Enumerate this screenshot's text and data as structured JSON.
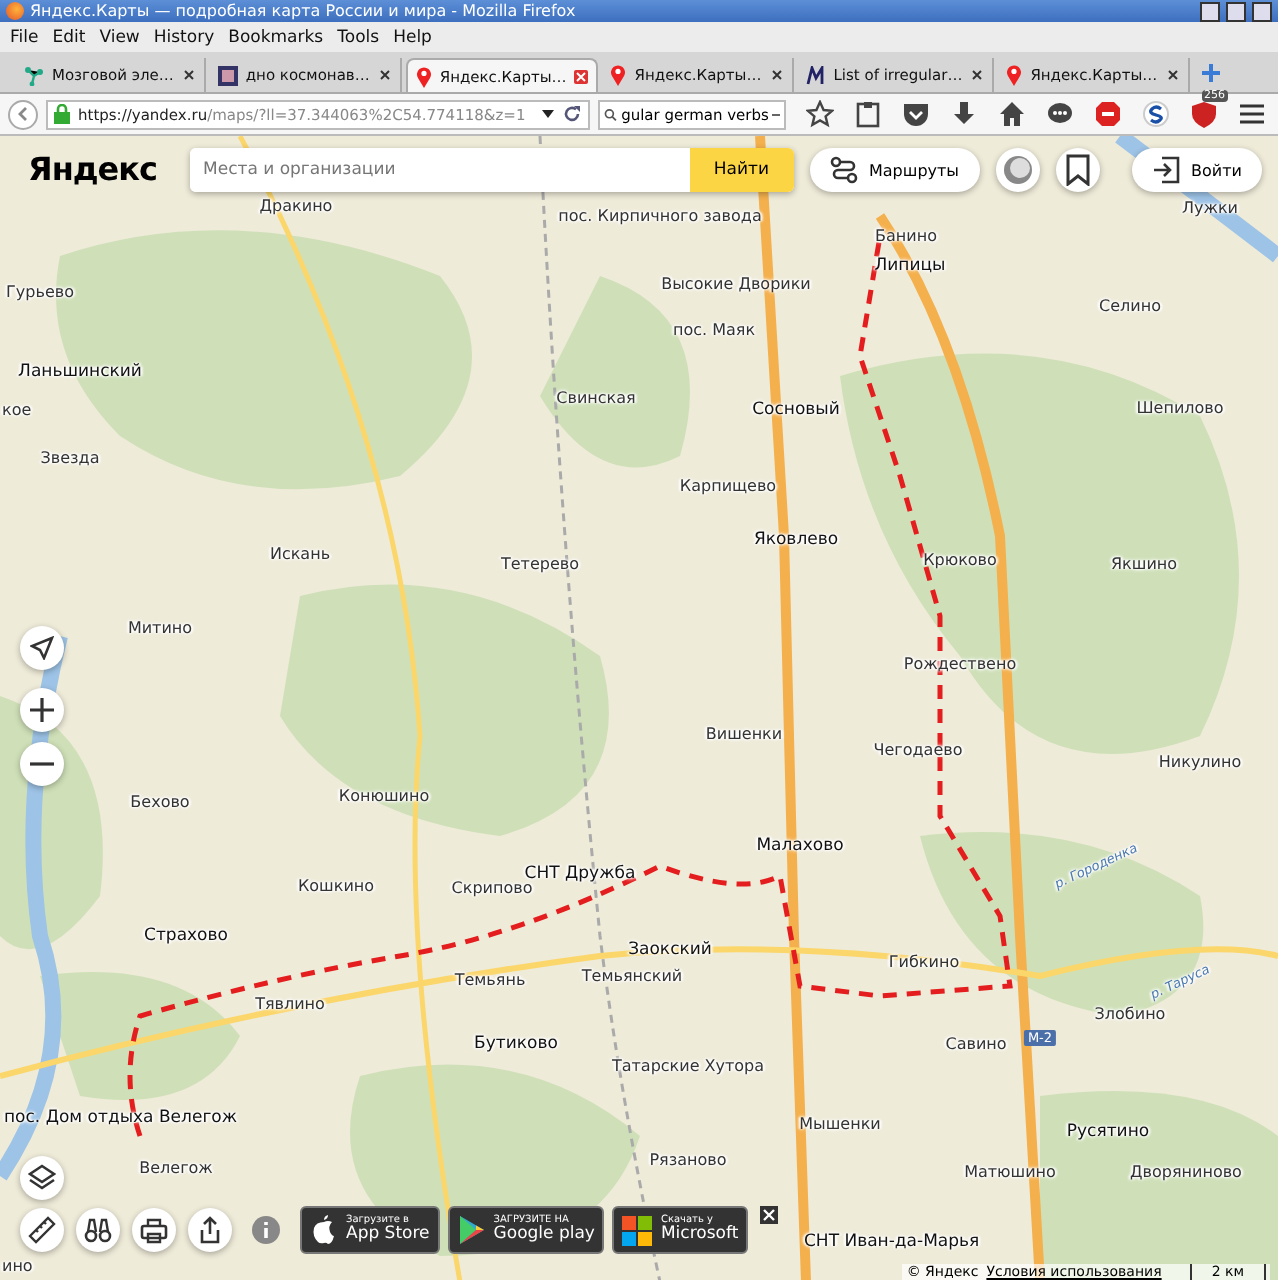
{
  "window": {
    "title": "Яндекс.Карты — подробная карта России и мира - Mozilla Firefox"
  },
  "menu": [
    "File",
    "Edit",
    "View",
    "History",
    "Bookmarks",
    "Tools",
    "Help"
  ],
  "tabs": [
    {
      "label": "Мозговой эле…",
      "kind": "nodes",
      "selected": false
    },
    {
      "label": "дно космонав…",
      "kind": "image",
      "selected": false
    },
    {
      "label": "Яндекс.Карты…",
      "kind": "pin",
      "selected": true
    },
    {
      "label": "Яндекс.Карты…",
      "kind": "pin",
      "selected": false
    },
    {
      "label": "List of irregular…",
      "kind": "letter",
      "selected": false
    },
    {
      "label": "Яндекс.Карты…",
      "kind": "pin",
      "selected": false
    }
  ],
  "address": {
    "host": "https://yandex.ru",
    "path": "/maps/?ll=37.344063%2C54.774118&z=1"
  },
  "web_search": {
    "value": "gular german verbs"
  },
  "toolbar": {
    "badge": "256"
  },
  "header": {
    "logo": "Яндекс",
    "search_placeholder": "Места и организации",
    "search_button": "Найти",
    "routes_button": "Маршруты",
    "login_button": "Войти"
  },
  "map": {
    "labels": [
      {
        "text": "Дракино",
        "kind": "place"
      },
      {
        "text": "пос. Кирпичного завода",
        "kind": "place"
      },
      {
        "text": "Лужки",
        "kind": "place"
      },
      {
        "text": "Банино",
        "kind": "place"
      },
      {
        "text": "Липицы",
        "kind": "town"
      },
      {
        "text": "Гурьево",
        "kind": "place"
      },
      {
        "text": "Высокие Дворики",
        "kind": "place"
      },
      {
        "text": "Селино",
        "kind": "place"
      },
      {
        "text": "пос. Маяк",
        "kind": "place"
      },
      {
        "text": "Ланьшинский",
        "kind": "town"
      },
      {
        "text": "кое",
        "kind": "place"
      },
      {
        "text": "Свинская",
        "kind": "place"
      },
      {
        "text": "Сосновый",
        "kind": "town"
      },
      {
        "text": "Шепилово",
        "kind": "place"
      },
      {
        "text": "Звезда",
        "kind": "place"
      },
      {
        "text": "Карпищево",
        "kind": "place"
      },
      {
        "text": "Яковлево",
        "kind": "town"
      },
      {
        "text": "Тетерево",
        "kind": "place"
      },
      {
        "text": "Искань",
        "kind": "place"
      },
      {
        "text": "Крюково",
        "kind": "place"
      },
      {
        "text": "Якшино",
        "kind": "place"
      },
      {
        "text": "Митино",
        "kind": "place"
      },
      {
        "text": "Рождествено",
        "kind": "place"
      },
      {
        "text": "Вишенки",
        "kind": "place"
      },
      {
        "text": "Чегодаево",
        "kind": "place"
      },
      {
        "text": "Никулино",
        "kind": "place"
      },
      {
        "text": "Бехово",
        "kind": "place"
      },
      {
        "text": "Конюшино",
        "kind": "place"
      },
      {
        "text": "Малахово",
        "kind": "town"
      },
      {
        "text": "р. Городенка",
        "kind": "river"
      },
      {
        "text": "Кошкино",
        "kind": "place"
      },
      {
        "text": "Скрипово",
        "kind": "place"
      },
      {
        "text": "СНТ Дружба",
        "kind": "town"
      },
      {
        "text": "Страхово",
        "kind": "town"
      },
      {
        "text": "Заокский",
        "kind": "town"
      },
      {
        "text": "Темьянский",
        "kind": "place"
      },
      {
        "text": "Темьянь",
        "kind": "place"
      },
      {
        "text": "Гибкино",
        "kind": "place"
      },
      {
        "text": "Тявлино",
        "kind": "place"
      },
      {
        "text": "Злобино",
        "kind": "place"
      },
      {
        "text": "р. Таруса",
        "kind": "river"
      },
      {
        "text": "Бутиково",
        "kind": "town"
      },
      {
        "text": "Савино",
        "kind": "place"
      },
      {
        "text": "М-2",
        "kind": "road"
      },
      {
        "text": "Татарские Хутора",
        "kind": "place"
      },
      {
        "text": "пос. Дом отдыха Велегож",
        "kind": "town"
      },
      {
        "text": "Мышенки",
        "kind": "place"
      },
      {
        "text": "Русятино",
        "kind": "town"
      },
      {
        "text": "Рязаново",
        "kind": "place"
      },
      {
        "text": "Велегож",
        "kind": "place"
      },
      {
        "text": "Матюшино",
        "kind": "place"
      },
      {
        "text": "Дворяниново",
        "kind": "place"
      },
      {
        "text": "СНТ Иван-да-Марья",
        "kind": "town"
      },
      {
        "text": "ино",
        "kind": "place"
      }
    ]
  },
  "app_badges": [
    {
      "kind": "apple",
      "small": "Загрузите в",
      "big": "App Store"
    },
    {
      "kind": "google",
      "small": "ЗАГРУЗИТЕ НА",
      "big": "Google play"
    },
    {
      "kind": "microsoft",
      "small": "Скачать у",
      "big": "Microsoft"
    }
  ],
  "footer": {
    "copyright": "© Яндекс",
    "terms": "Условия использования",
    "scale": "2 км"
  }
}
